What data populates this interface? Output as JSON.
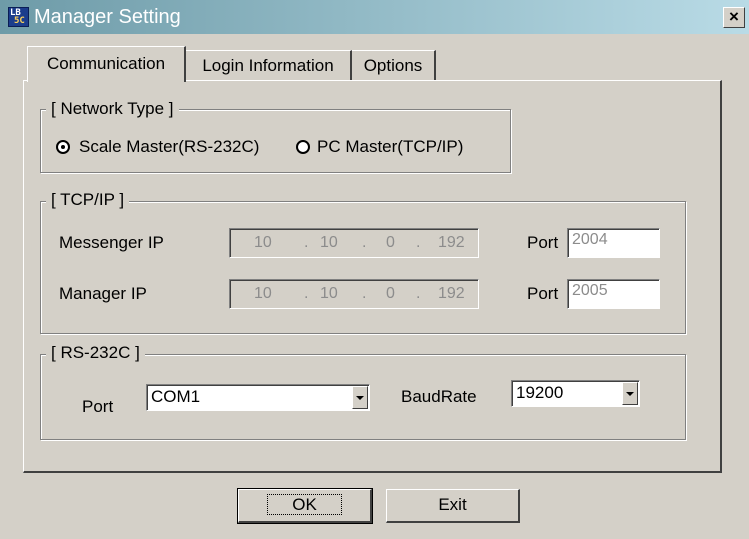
{
  "window": {
    "title": "Manager Setting",
    "close_label": "×",
    "app_icon_text": [
      "LB",
      "5C"
    ]
  },
  "tabs": [
    {
      "label": "Communication",
      "active": true
    },
    {
      "label": "Login Information",
      "active": false
    },
    {
      "label": "Options",
      "active": false
    }
  ],
  "tab_separators": [
    "|",
    "|",
    "|"
  ],
  "network_type": {
    "legend": "[ Network Type ]",
    "options": [
      {
        "label": "Scale Master(RS-232C)",
        "checked": true
      },
      {
        "label": "PC Master(TCP/IP)",
        "checked": false
      }
    ]
  },
  "tcpip": {
    "legend": "[ TCP/IP ]",
    "rows": [
      {
        "label": "Messenger IP",
        "ip": [
          "10",
          "10",
          "0",
          "192"
        ],
        "port_label": "Port",
        "port": "2004"
      },
      {
        "label": "Manager IP",
        "ip": [
          "10",
          "10",
          "0",
          "192"
        ],
        "port_label": "Port",
        "port": "2005"
      }
    ],
    "ip_dot": "."
  },
  "rs232c": {
    "legend": "[ RS-232C ]",
    "port_label": "Port",
    "port_value": "COM1",
    "baud_label": "BaudRate",
    "baud_value": "19200"
  },
  "buttons": {
    "ok": "OK",
    "exit": "Exit"
  }
}
